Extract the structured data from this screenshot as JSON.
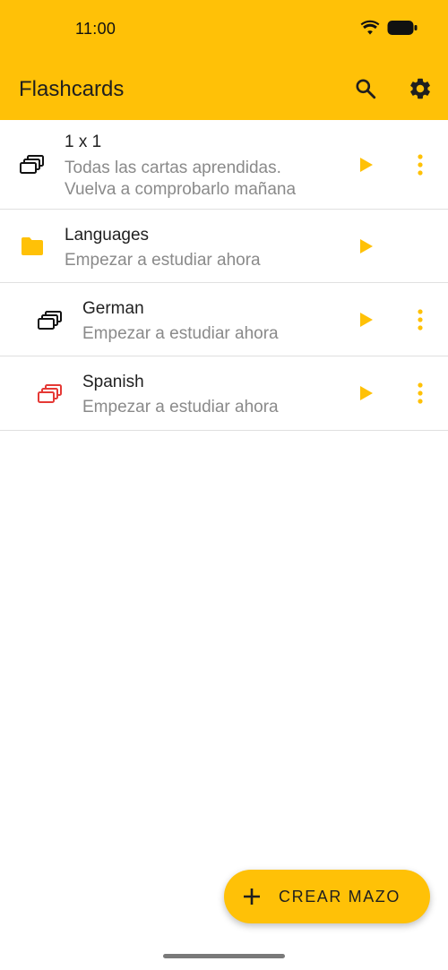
{
  "status_bar": {
    "time": "11:00"
  },
  "app_bar": {
    "title": "Flashcards",
    "icons": [
      "search-icon",
      "settings-icon"
    ]
  },
  "decks": [
    {
      "name": "1 x 1",
      "status": "Todas las cartas aprendidas.",
      "status_line2": "Vuelva a comprobarlo mañana",
      "icon": "deck-icon",
      "icon_color": "#111111"
    },
    {
      "name": "Languages",
      "status": "Empezar a estudiar ahora",
      "icon": "folder-icon",
      "icon_color": "#FFC107"
    },
    {
      "name": "German",
      "status": "Empezar a estudiar ahora",
      "icon": "deck-icon",
      "icon_color": "#111111"
    },
    {
      "name": "Spanish",
      "status": "Empezar a estudiar ahora",
      "icon": "deck-icon",
      "icon_color": "#E53935"
    }
  ],
  "fab": {
    "label": "CREAR MAZO",
    "icon": "plus-icon"
  },
  "colors": {
    "accent": "#FFC107",
    "text_primary": "#212121",
    "text_secondary": "#8a8a8a",
    "spanish_icon": "#E53935"
  }
}
